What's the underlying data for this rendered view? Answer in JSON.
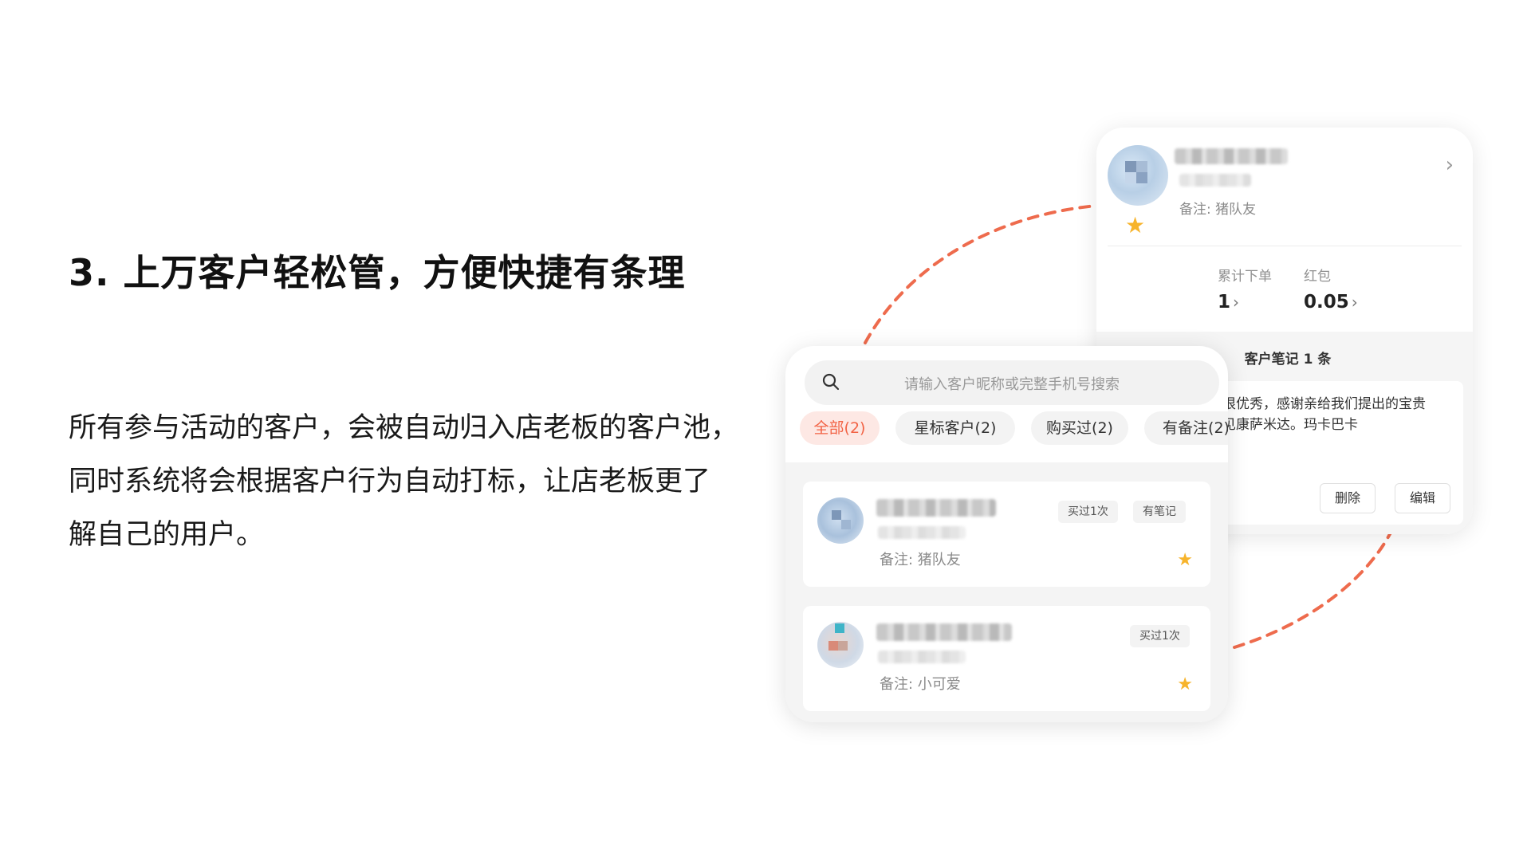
{
  "headline": "3. 上万客户轻松管，方便快捷有条理",
  "description": [
    "所有参与活动的客户，会被自动归入店老板的客户池，",
    "同时系统将会根据客户行为自动打标，让店老板更了",
    "解自己的用户。"
  ],
  "colors": {
    "accent": "#f26345",
    "dash": "#ee6b4d",
    "star": "#f7b42c"
  },
  "detail_card": {
    "note": "备注: 猪队友",
    "star_icon": "star-icon",
    "chevron": "›",
    "stats": [
      {
        "label": "累计下单",
        "value": "1"
      },
      {
        "label": "红包",
        "value": "0.05"
      }
    ],
    "notes_title": "客户笔记 1 条",
    "note_lines": [
      "很优秀，感谢亲给我们提出的宝贵",
      "见康萨米达。玛卡巴卡"
    ],
    "delete_label": "删除",
    "edit_label": "编辑"
  },
  "list_card": {
    "search_placeholder": "请输入客户昵称或完整手机号搜索",
    "tabs": [
      {
        "label": "全部(2)",
        "active": true
      },
      {
        "label": "星标客户(2)",
        "active": false
      },
      {
        "label": "购买过(2)",
        "active": false
      },
      {
        "label": "有备注(2)",
        "active": false
      }
    ],
    "customers": [
      {
        "note": "备注: 猪队友",
        "tags": [
          "买过1次",
          "有笔记"
        ],
        "starred": true
      },
      {
        "note": "备注: 小可爱",
        "tags": [
          "买过1次"
        ],
        "starred": true
      }
    ]
  }
}
